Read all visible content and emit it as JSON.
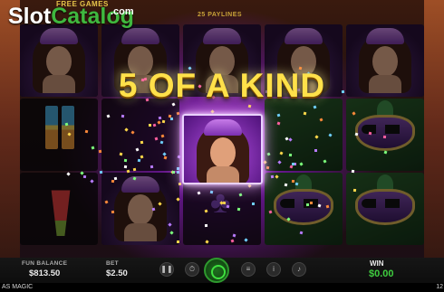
{
  "logo": {
    "part1": "Slot",
    "part2": "Catalog",
    "domain": ".com"
  },
  "header": {
    "free_games": "FREE GAMES",
    "paylines": "25 PAYLINES"
  },
  "win_banner": "5 OF A KIND",
  "bottom": {
    "balance_label": "FUN BALANCE",
    "balance_value": "$813.50",
    "bet_label": "BET",
    "bet_value": "$2.50",
    "win_label": "WIN",
    "win_value": "$0.00"
  },
  "controls": [
    "pause-icon",
    "clock-icon",
    "spin-icon",
    "stack-icon",
    "info-icon",
    "sound-icon"
  ],
  "title_bar": {
    "game_title": "AS MAGIC",
    "clock": "12"
  },
  "colors": {
    "logo_green": "#3fb83f",
    "banner_gold": "#ffe14a",
    "win_green": "#3fcd3f",
    "highlight_purple": "#b44fe2"
  }
}
